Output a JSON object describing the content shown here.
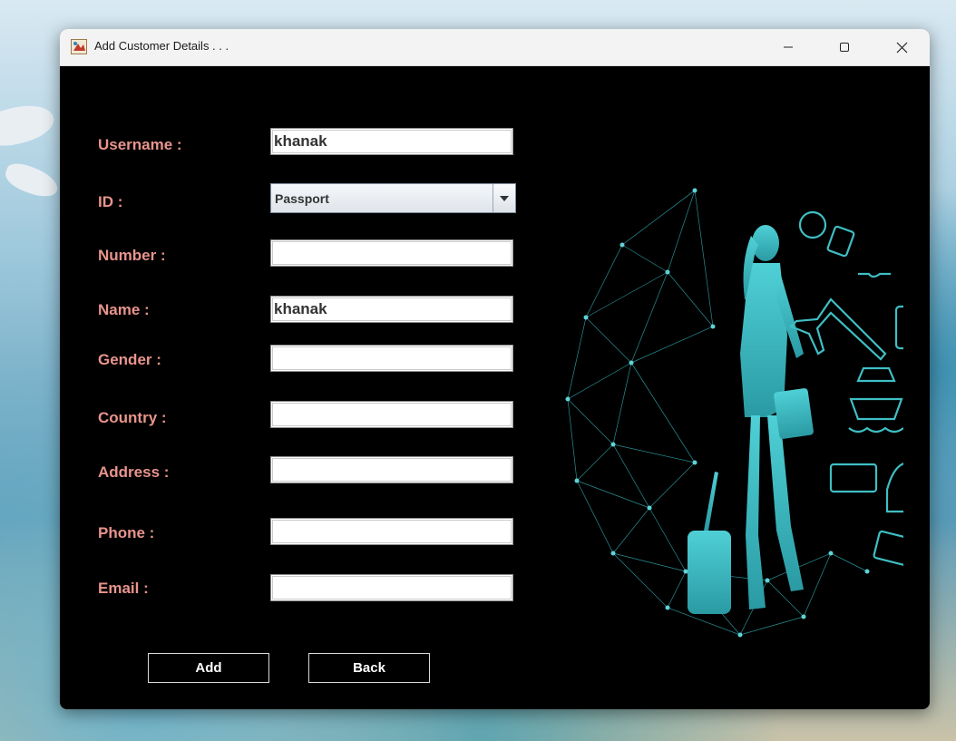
{
  "window": {
    "title": "Add Customer Details . . .",
    "controls": {
      "minimize": "—",
      "maximize": "☐",
      "close": "✕"
    }
  },
  "form": {
    "username": {
      "label": "Username :",
      "value": "khanak"
    },
    "id": {
      "label": "ID :",
      "selected": "Passport"
    },
    "number": {
      "label": "Number :",
      "value": ""
    },
    "name": {
      "label": "Name :",
      "value": "khanak"
    },
    "gender": {
      "label": "Gender :",
      "value": ""
    },
    "country": {
      "label": "Country :",
      "value": ""
    },
    "address": {
      "label": "Address :",
      "value": ""
    },
    "phone": {
      "label": "Phone :",
      "value": ""
    },
    "email": {
      "label": "Email :",
      "value": ""
    }
  },
  "buttons": {
    "add": "Add",
    "back": "Back"
  },
  "colors": {
    "label": "#e8948c",
    "accent_teal": "#3fbfc4",
    "window_bg": "#000000"
  }
}
